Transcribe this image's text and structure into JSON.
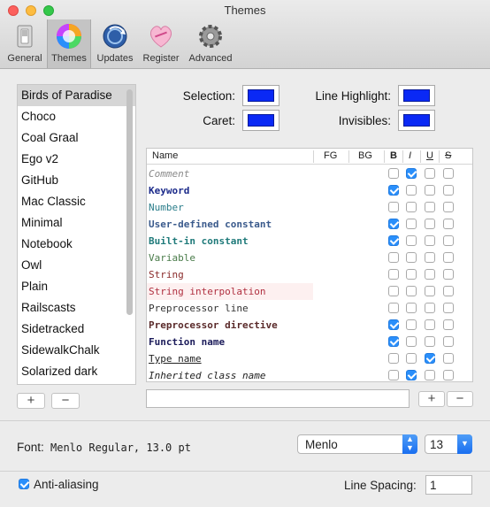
{
  "window": {
    "title": "Themes"
  },
  "toolbar": [
    {
      "label": "General",
      "icon": "switch-icon"
    },
    {
      "label": "Themes",
      "icon": "color-wheel-icon"
    },
    {
      "label": "Updates",
      "icon": "globe-update-icon"
    },
    {
      "label": "Register",
      "icon": "heart-candy-icon"
    },
    {
      "label": "Advanced",
      "icon": "gear-icon"
    }
  ],
  "themes": [
    "Birds of Paradise",
    "Choco",
    "Coal Graal",
    "Ego v2",
    "GitHub",
    "Mac Classic",
    "Minimal",
    "Notebook",
    "Owl",
    "Plain",
    "Railscasts",
    "Sidetracked",
    "SidewalkChalk",
    "Solarized dark"
  ],
  "theme_buttons": {
    "add": "+",
    "remove": "−"
  },
  "colors": {
    "selection": "Selection:",
    "line_highlight": "Line Highlight:",
    "caret": "Caret:",
    "invisibles": "Invisibles:",
    "swatch": "#0a29f5"
  },
  "syntax": {
    "headers": {
      "name": "Name",
      "fg": "FG",
      "bg": "BG",
      "b": "B",
      "i": "I",
      "u": "U",
      "s": "S"
    },
    "rows": [
      {
        "name": "Comment",
        "color": "#8a8a8a",
        "italic": true,
        "bold": false,
        "underline": false,
        "bg": "",
        "b": false,
        "i": true,
        "u": false,
        "s": false
      },
      {
        "name": "Keyword",
        "color": "#1b2a8a",
        "italic": false,
        "bold": true,
        "underline": false,
        "bg": "",
        "b": true,
        "i": false,
        "u": false,
        "s": false
      },
      {
        "name": "Number",
        "color": "#2a7d8a",
        "italic": false,
        "bold": false,
        "underline": false,
        "bg": "",
        "b": false,
        "i": false,
        "u": false,
        "s": false
      },
      {
        "name": "User-defined constant",
        "color": "#3a5a8c",
        "italic": false,
        "bold": true,
        "underline": false,
        "bg": "",
        "b": true,
        "i": false,
        "u": false,
        "s": false
      },
      {
        "name": "Built-in constant",
        "color": "#1f7a7a",
        "italic": false,
        "bold": true,
        "underline": false,
        "bg": "",
        "b": true,
        "i": false,
        "u": false,
        "s": false
      },
      {
        "name": "Variable",
        "color": "#4a7c4a",
        "italic": false,
        "bold": false,
        "underline": false,
        "bg": "",
        "b": false,
        "i": false,
        "u": false,
        "s": false
      },
      {
        "name": "String",
        "color": "#8a2a2a",
        "italic": false,
        "bold": false,
        "underline": false,
        "bg": "",
        "b": false,
        "i": false,
        "u": false,
        "s": false
      },
      {
        "name": "String interpolation",
        "color": "#b03040",
        "italic": false,
        "bold": false,
        "underline": false,
        "bg": "#fdf0f0",
        "b": false,
        "i": false,
        "u": false,
        "s": false
      },
      {
        "name": "Preprocessor line",
        "color": "#333333",
        "italic": false,
        "bold": false,
        "underline": false,
        "bg": "",
        "b": false,
        "i": false,
        "u": false,
        "s": false
      },
      {
        "name": "Preprocessor directive",
        "color": "#5a2a2a",
        "italic": false,
        "bold": true,
        "underline": false,
        "bg": "",
        "b": true,
        "i": false,
        "u": false,
        "s": false
      },
      {
        "name": "Function name",
        "color": "#1b1b5a",
        "italic": false,
        "bold": true,
        "underline": false,
        "bg": "",
        "b": true,
        "i": false,
        "u": false,
        "s": false
      },
      {
        "name": "Type name",
        "color": "#222222",
        "italic": false,
        "bold": false,
        "underline": true,
        "bg": "",
        "b": false,
        "i": false,
        "u": true,
        "s": false
      },
      {
        "name": "Inherited class name",
        "color": "#222222",
        "italic": true,
        "bold": false,
        "underline": false,
        "bg": "",
        "b": false,
        "i": true,
        "u": false,
        "s": false
      }
    ]
  },
  "syntax_buttons": {
    "add": "+",
    "remove": "−"
  },
  "font": {
    "label": "Font:",
    "value": "Menlo Regular, 13.0 pt",
    "family": "Menlo",
    "size": "13"
  },
  "anti_aliasing": {
    "label": "Anti-aliasing",
    "checked": true
  },
  "line_spacing": {
    "label": "Line Spacing:",
    "value": "1"
  }
}
